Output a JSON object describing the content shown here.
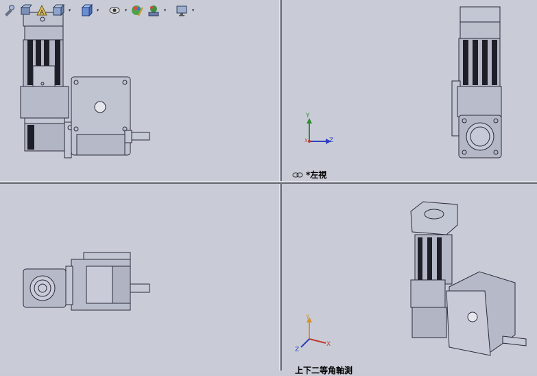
{
  "toolbar": {
    "items": [
      {
        "name": "zoom-to-fit-icon"
      },
      {
        "name": "section-view-icon"
      },
      {
        "name": "dynamic-annotation-icon"
      },
      {
        "name": "view-orientation-icon"
      },
      {
        "name": "display-style-icon"
      },
      {
        "name": "hide-show-items-icon"
      },
      {
        "name": "edit-appearance-icon"
      },
      {
        "name": "apply-scene-icon"
      },
      {
        "name": "view-settings-icon"
      }
    ]
  },
  "viewports": {
    "top_right": {
      "label": "*左視"
    },
    "bottom_right": {
      "label": "上下二等角軸測"
    }
  },
  "triad_top_right": {
    "y": "Y",
    "z": "Z",
    "x": "X"
  },
  "triad_bottom_right": {
    "y": "Y",
    "z": "Z",
    "x": "X"
  },
  "colors": {
    "background": "#c9ccd7",
    "part_fill": "#b9bccb",
    "part_stroke": "#2a2a3a",
    "axis_y": "#2e8b2e",
    "axis_z": "#2d3fbf",
    "axis_x": "#c0392b",
    "axis_y_iso": "#d9902a"
  }
}
